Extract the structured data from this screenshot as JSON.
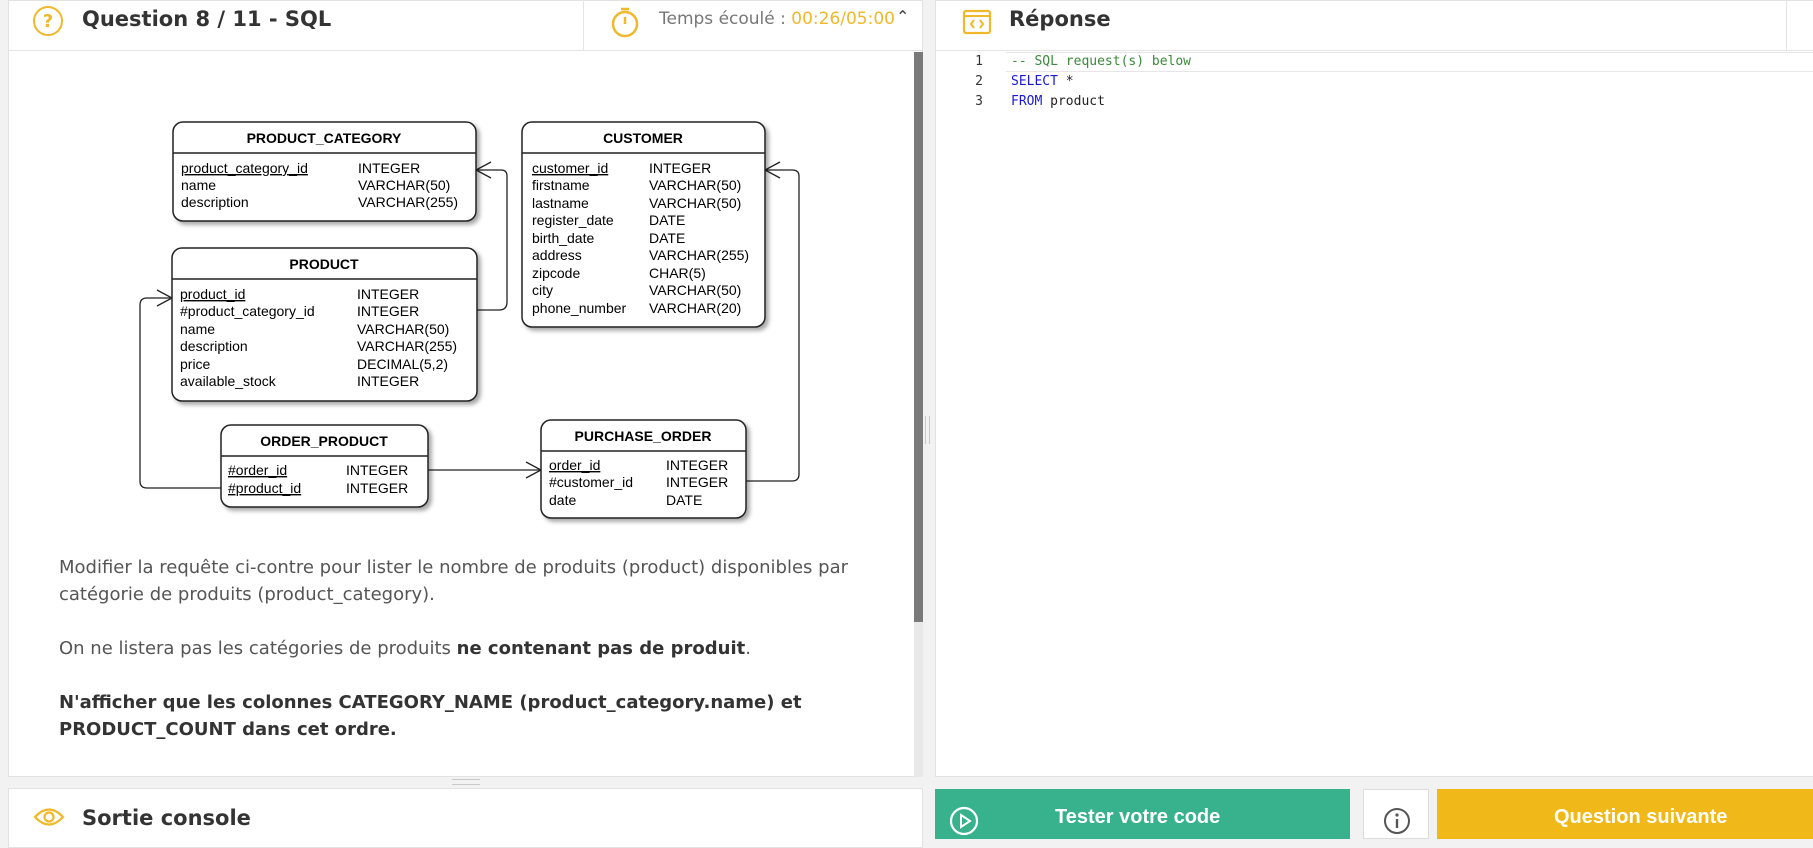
{
  "question": {
    "icon": "question-circle-icon",
    "title": "Question 8 / 11 - SQL",
    "timer_label": "Temps écoulé : ",
    "timer_value": "00:26/05:00",
    "timer_icon": "stopwatch-icon",
    "collapse_icon": "chevron-up-icon"
  },
  "diagram": {
    "tables": [
      {
        "name": "PRODUCT_CATEGORY",
        "columns": [
          [
            "product_category_id",
            "INTEGER"
          ],
          [
            "name",
            "VARCHAR(50)"
          ],
          [
            "description",
            "VARCHAR(255)"
          ]
        ]
      },
      {
        "name": "CUSTOMER",
        "columns": [
          [
            "customer_id",
            "INTEGER"
          ],
          [
            "firstname",
            "VARCHAR(50)"
          ],
          [
            "lastname",
            "VARCHAR(50)"
          ],
          [
            "register_date",
            "DATE"
          ],
          [
            "birth_date",
            "DATE"
          ],
          [
            "address",
            "VARCHAR(255)"
          ],
          [
            "zipcode",
            "CHAR(5)"
          ],
          [
            "city",
            "VARCHAR(50)"
          ],
          [
            "phone_number",
            "VARCHAR(20)"
          ]
        ]
      },
      {
        "name": "PRODUCT",
        "columns": [
          [
            "product_id",
            "INTEGER"
          ],
          [
            "#product_category_id",
            "INTEGER"
          ],
          [
            "name",
            "VARCHAR(50)"
          ],
          [
            "description",
            "VARCHAR(255)"
          ],
          [
            "price",
            "DECIMAL(5,2)"
          ],
          [
            "available_stock",
            "INTEGER"
          ]
        ]
      },
      {
        "name": "ORDER_PRODUCT",
        "columns": [
          [
            "#order_id",
            "INTEGER"
          ],
          [
            "#product_id",
            "INTEGER"
          ]
        ]
      },
      {
        "name": "PURCHASE_ORDER",
        "columns": [
          [
            "order_id",
            "INTEGER"
          ],
          [
            "#customer_id",
            "INTEGER"
          ],
          [
            "date",
            "DATE"
          ]
        ]
      }
    ]
  },
  "instructions": {
    "p1": "Modifier la requête ci-contre pour lister le nombre de produits (product) disponibles par catégorie de produits (product_category).",
    "p2_pre": "On ne listera pas les catégories de produits ",
    "p2_bold": "ne contenant pas de produit",
    "p2_post": ".",
    "p3": "N'afficher que les colonnes CATEGORY_NAME (product_category.name) et PRODUCT_COUNT dans cet ordre."
  },
  "response": {
    "icon": "code-brackets-icon",
    "title": "Réponse",
    "lines": [
      {
        "num": "1",
        "parts": [
          {
            "cls": "cmt",
            "text": "-- SQL request(s) below"
          }
        ]
      },
      {
        "num": "2",
        "parts": [
          {
            "cls": "kw",
            "text": "SELECT"
          },
          {
            "cls": "plain",
            "text": " *"
          }
        ]
      },
      {
        "num": "3",
        "parts": [
          {
            "cls": "kw",
            "text": "FROM"
          },
          {
            "cls": "plain",
            "text": " product"
          }
        ]
      }
    ]
  },
  "console": {
    "icon": "eye-icon",
    "title": "Sortie console"
  },
  "buttons": {
    "test": "Tester votre code",
    "test_icon": "play-circle-icon",
    "info_icon": "info-icon",
    "next": "Question suivante"
  },
  "colors": {
    "accent": "#f0b82a",
    "test_green": "#37b28d",
    "next_yellow": "#f0b818"
  }
}
